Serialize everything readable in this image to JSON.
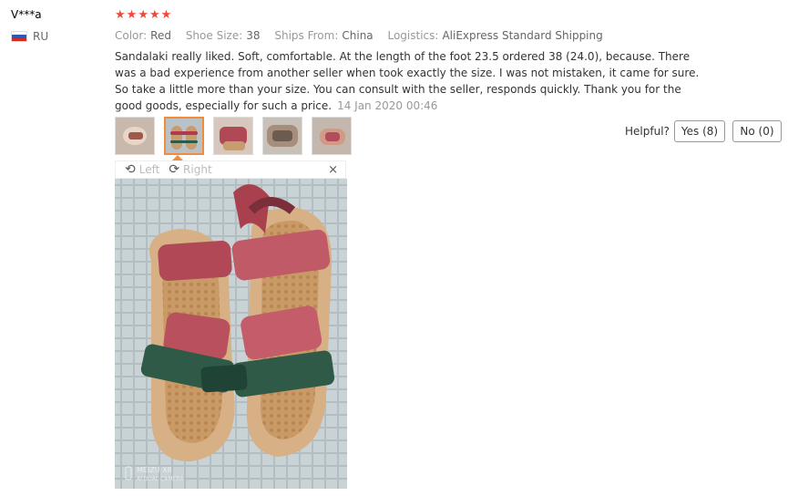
{
  "reviewer": {
    "name": "V***a",
    "country": "RU"
  },
  "rating": {
    "stars": 5,
    "color": "#f0493a"
  },
  "attributes": [
    {
      "key": "Color:",
      "value": "Red"
    },
    {
      "key": "Shoe Size:",
      "value": "38"
    },
    {
      "key": "Ships From:",
      "value": "China"
    },
    {
      "key": "Logistics:",
      "value": "AliExpress Standard Shipping"
    }
  ],
  "review": {
    "text": "Sandalaki really liked. Soft, comfortable. At the length of the foot 23.5 ordered 38 (24.0), because. There was a bad experience from another seller when took exactly the size. I was not mistaken, it came for sure. So take a little more than your size. You can consult with the seller, responds quickly. Thank you for the good goods, especially for such a price.",
    "date": "14 Jan 2020 00:46"
  },
  "thumbnails": [
    {
      "name": "thumb-1",
      "active": false
    },
    {
      "name": "thumb-2",
      "active": true
    },
    {
      "name": "thumb-3",
      "active": false
    },
    {
      "name": "thumb-4",
      "active": false
    },
    {
      "name": "thumb-5",
      "active": false
    }
  ],
  "viewer": {
    "rotate_left": "Left",
    "rotate_right": "Right",
    "close": "×",
    "watermark_1": "MEIZU X8",
    "watermark_2": "AI DUAL CAMERA"
  },
  "feedback": {
    "label": "Helpful?",
    "yes": "Yes (8)",
    "no": "No (0)"
  }
}
